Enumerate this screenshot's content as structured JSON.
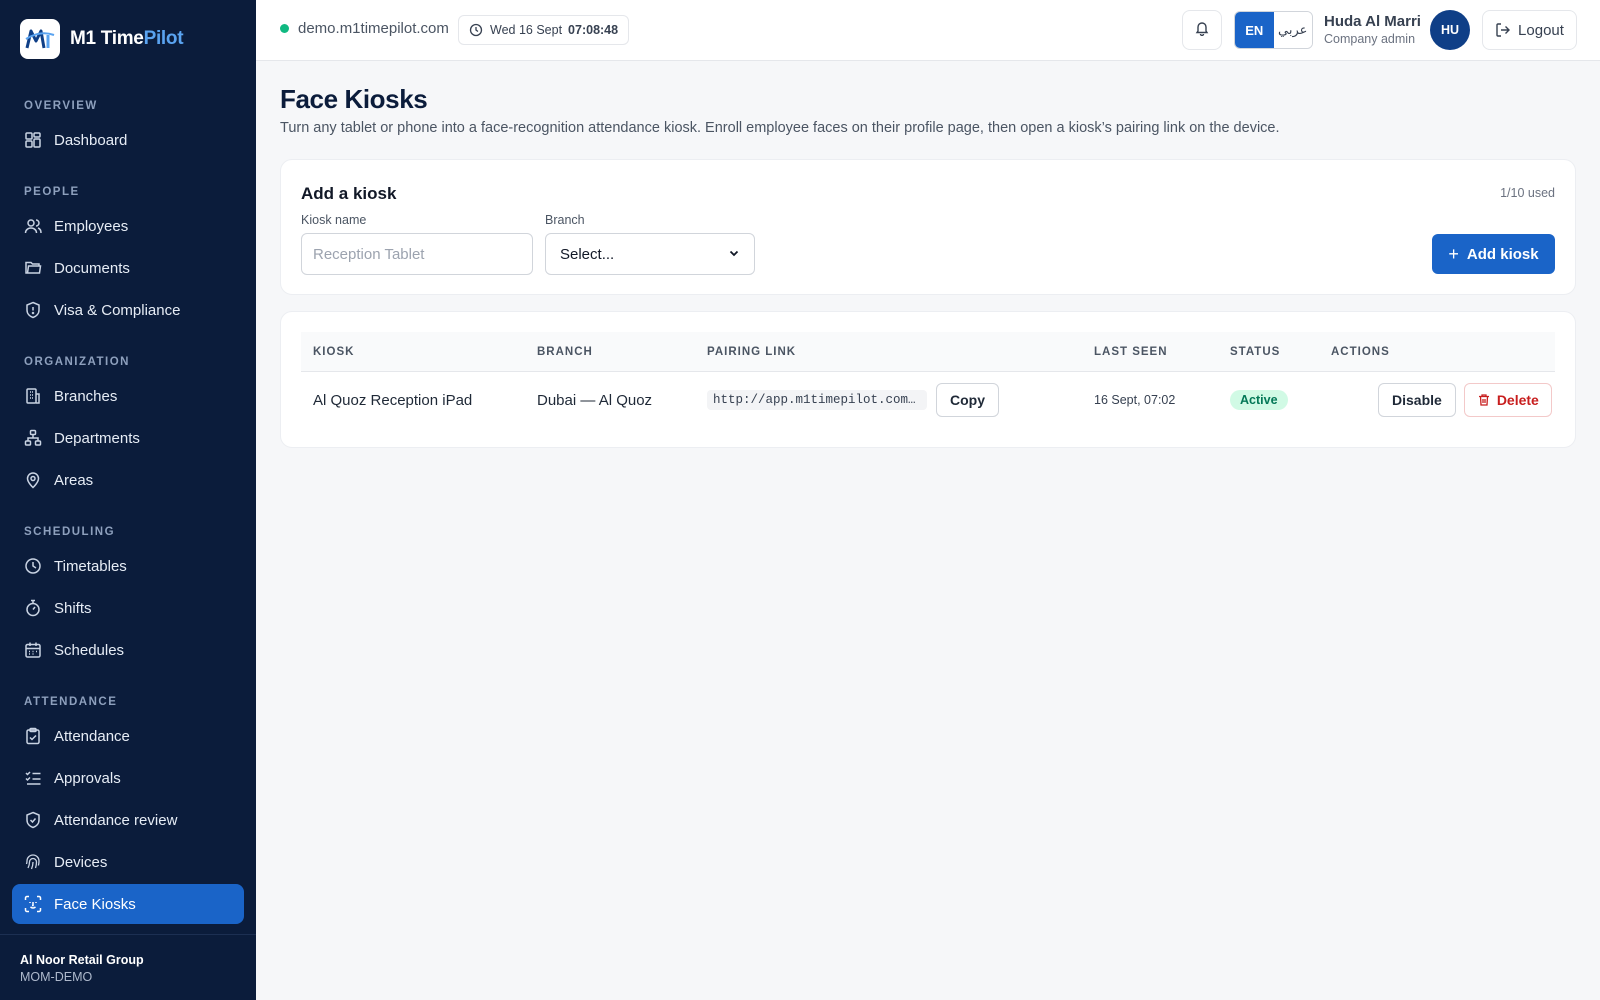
{
  "brand": {
    "name_main": "M1 Time",
    "name_accent": "Pilot"
  },
  "sidebar": {
    "sections": [
      {
        "title": "OVERVIEW",
        "items": [
          {
            "label": "Dashboard",
            "icon": "dashboard-icon"
          }
        ]
      },
      {
        "title": "PEOPLE",
        "items": [
          {
            "label": "Employees",
            "icon": "users-icon"
          },
          {
            "label": "Documents",
            "icon": "folder-icon"
          },
          {
            "label": "Visa & Compliance",
            "icon": "shield-icon"
          }
        ]
      },
      {
        "title": "ORGANIZATION",
        "items": [
          {
            "label": "Branches",
            "icon": "building-icon"
          },
          {
            "label": "Departments",
            "icon": "hierarchy-icon"
          },
          {
            "label": "Areas",
            "icon": "map-pin-icon"
          }
        ]
      },
      {
        "title": "SCHEDULING",
        "items": [
          {
            "label": "Timetables",
            "icon": "clock-icon"
          },
          {
            "label": "Shifts",
            "icon": "stopwatch-icon"
          },
          {
            "label": "Schedules",
            "icon": "calendar-icon"
          }
        ]
      },
      {
        "title": "ATTENDANCE",
        "items": [
          {
            "label": "Attendance",
            "icon": "clipboard-check-icon"
          },
          {
            "label": "Approvals",
            "icon": "list-check-icon"
          },
          {
            "label": "Attendance review",
            "icon": "shield-check-icon"
          },
          {
            "label": "Devices",
            "icon": "fingerprint-icon"
          },
          {
            "label": "Face Kiosks",
            "icon": "face-scan-icon",
            "active": true
          }
        ]
      }
    ],
    "footer": {
      "org_name": "Al Noor Retail Group",
      "org_code": "MOM-DEMO"
    }
  },
  "topbar": {
    "host": "demo.m1timepilot.com",
    "date": "Wed 16 Sept",
    "time": "07:08:48",
    "lang_en": "EN",
    "lang_ar": "عربي",
    "user_name": "Huda Al Marri",
    "user_role": "Company admin",
    "avatar_initials": "HU",
    "logout_label": "Logout"
  },
  "page": {
    "title": "Face Kiosks",
    "subtitle": "Turn any tablet or phone into a face-recognition attendance kiosk. Enroll employee faces on their profile page, then open a kiosk’s pairing link on the device."
  },
  "add_kiosk": {
    "title": "Add a kiosk",
    "used": "1/10 used",
    "kiosk_name_label": "Kiosk name",
    "kiosk_name_placeholder": "Reception Tablet",
    "branch_label": "Branch",
    "branch_value": "Select...",
    "submit_label": "Add kiosk"
  },
  "table": {
    "columns": [
      "KIOSK",
      "BRANCH",
      "PAIRING LINK",
      "LAST SEEN",
      "STATUS",
      "ACTIONS"
    ],
    "rows": [
      {
        "kiosk": "Al Quoz Reception iPad",
        "branch": "Dubai — Al Quoz",
        "pairing_link": "http://app.m1timepilot.com/…",
        "copy_label": "Copy",
        "last_seen": "16 Sept, 07:02",
        "status": "Active",
        "disable_label": "Disable",
        "delete_label": "Delete"
      }
    ]
  },
  "colors": {
    "sidebar_bg": "#0b1c3b",
    "accent": "#1a64c8",
    "status_active": "#047857",
    "danger": "#c81e1e"
  }
}
